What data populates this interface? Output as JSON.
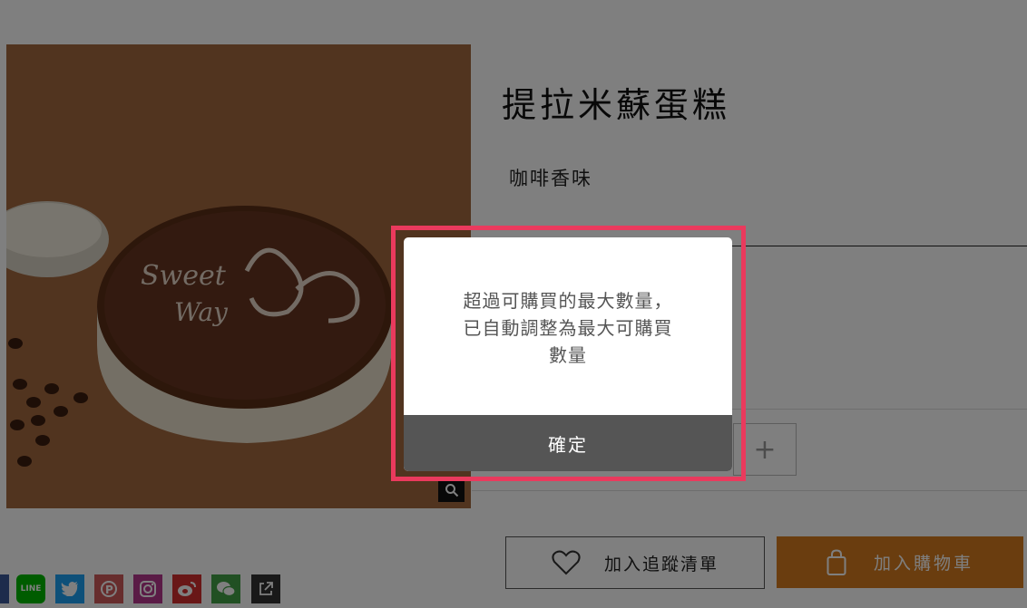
{
  "product": {
    "title": "提拉米蘇蛋糕",
    "flavor": "咖啡香味",
    "cake_text_line1": "Sweet",
    "cake_text_line2": "Way"
  },
  "quantity": {
    "increment_label": "+"
  },
  "actions": {
    "wishlist_label": "加入追蹤清單",
    "cart_label": "加入購物車"
  },
  "share": {
    "icons": [
      "facebook-icon",
      "line-icon",
      "twitter-icon",
      "plurk-icon",
      "instagram-icon",
      "weibo-icon",
      "wechat-icon",
      "external-share-icon"
    ],
    "line_label": "LINE"
  },
  "dialog": {
    "message_line1": "超過可購買的最大數量，",
    "message_line2": "已自動調整為最大可購買",
    "message_line3": "數量",
    "confirm_label": "確定"
  },
  "colors": {
    "highlight": "#ea3a5d",
    "cart_button": "#d47a1e",
    "confirm_button": "#555555"
  }
}
